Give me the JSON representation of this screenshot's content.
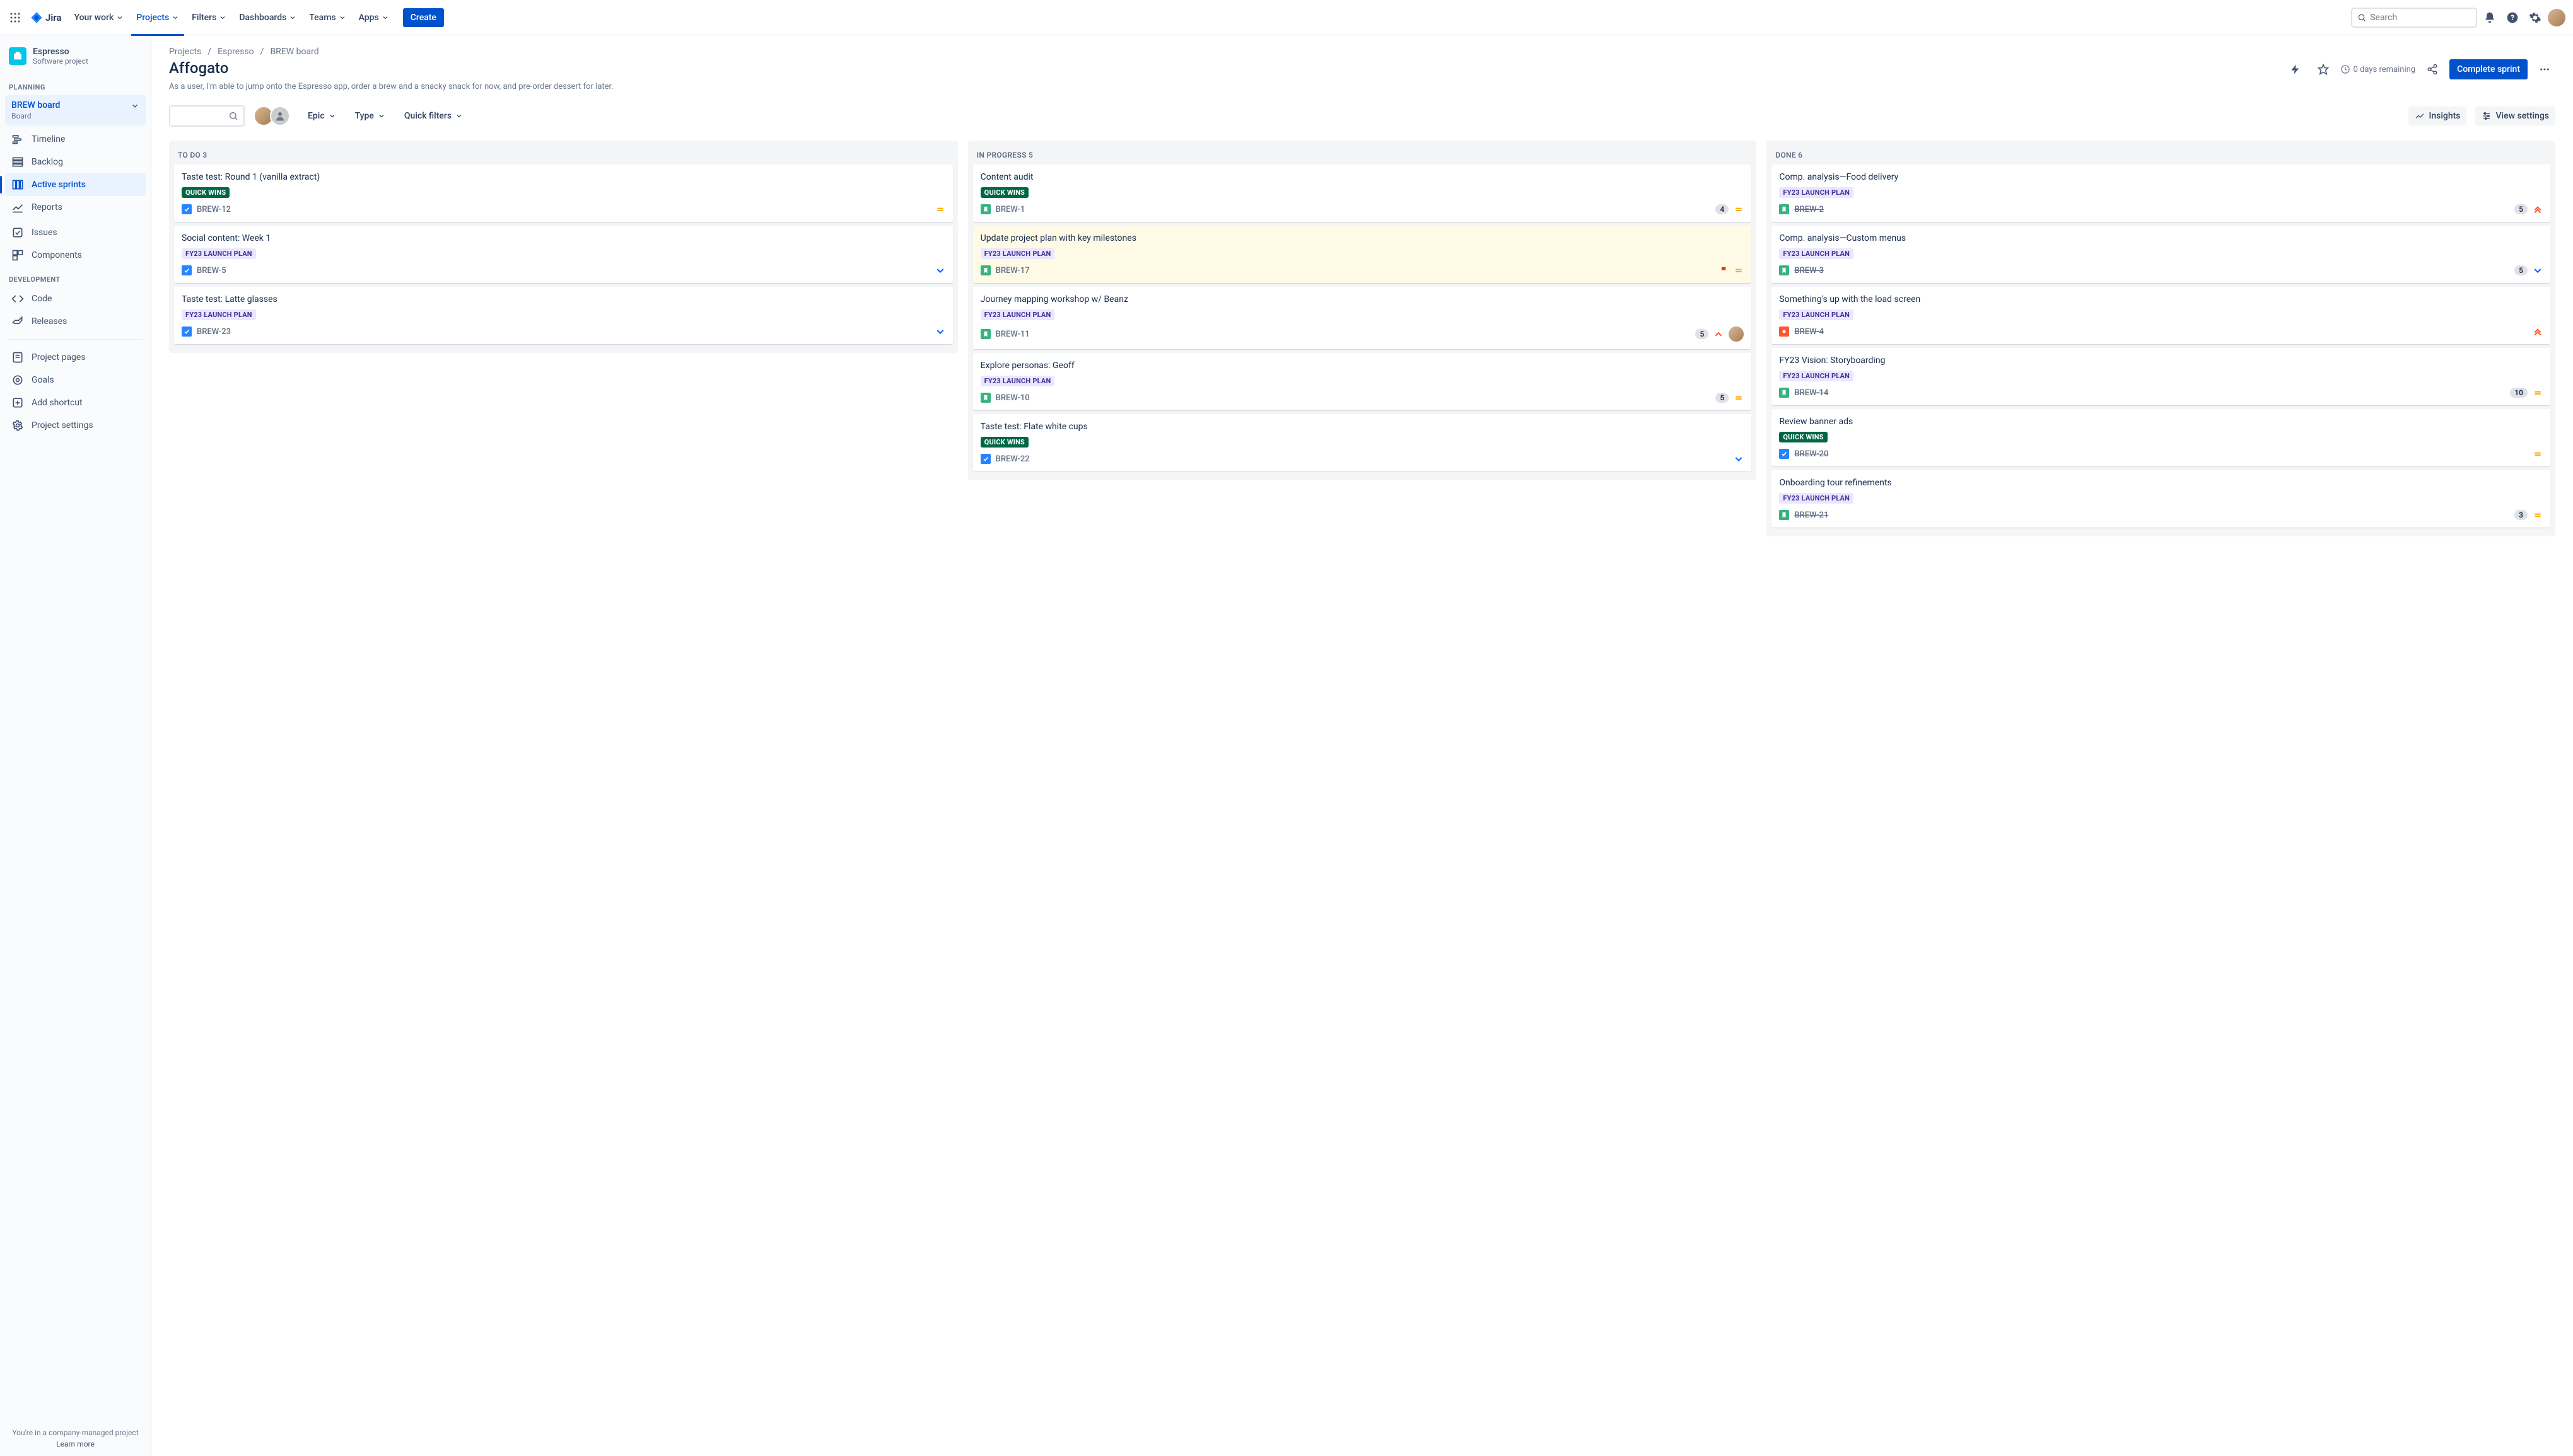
{
  "topbar": {
    "app": "Jira",
    "nav": [
      "Your work",
      "Projects",
      "Filters",
      "Dashboards",
      "Teams",
      "Apps"
    ],
    "nav_active": 1,
    "create": "Create",
    "search_placeholder": "Search"
  },
  "sidebar": {
    "project_name": "Espresso",
    "project_type": "Software project",
    "section_planning": "PLANNING",
    "board_title": "BREW board",
    "board_sub": "Board",
    "rows_plan": [
      "Timeline",
      "Backlog",
      "Active sprints",
      "Reports"
    ],
    "rows_plan_selected": 2,
    "rows_plain": [
      "Issues",
      "Components"
    ],
    "section_dev": "DEVELOPMENT",
    "rows_dev": [
      "Code",
      "Releases"
    ],
    "rows_bottom": [
      "Project pages",
      "Goals",
      "Add shortcut",
      "Project settings"
    ],
    "footer": "You're in a company-managed project",
    "footer_link": "Learn more"
  },
  "crumbs": [
    "Projects",
    "Espresso",
    "BREW board"
  ],
  "page": {
    "title": "Affogato",
    "desc": "As a user, I'm able to jump onto the Espresso app, order a brew and a snacky snack for now, and pre-order dessert for later.",
    "days": "0 days remaining",
    "complete": "Complete sprint"
  },
  "toolbar": {
    "drops": [
      "Epic",
      "Type",
      "Quick filters"
    ],
    "insights": "Insights",
    "viewsettings": "View settings"
  },
  "columns": [
    {
      "name": "TO DO",
      "count": 3,
      "cards": [
        {
          "title": "Taste test: Round 1 (vanilla extract)",
          "label": "QUICK WINS",
          "label_kind": "green",
          "type": "task",
          "key": "BREW-12",
          "done": false,
          "prio": "medium"
        },
        {
          "title": "Social content: Week 1",
          "label": "FY23 LAUNCH PLAN",
          "label_kind": "purple",
          "type": "task",
          "key": "BREW-5",
          "done": false,
          "prio": "low"
        },
        {
          "title": "Taste test: Latte glasses",
          "label": "FY23 LAUNCH PLAN",
          "label_kind": "purple",
          "type": "task",
          "key": "BREW-23",
          "done": false,
          "prio": "low"
        }
      ]
    },
    {
      "name": "IN PROGRESS",
      "count": 5,
      "cards": [
        {
          "title": "Content audit",
          "label": "QUICK WINS",
          "label_kind": "green",
          "type": "story",
          "key": "BREW-1",
          "done": false,
          "pts": 4,
          "prio": "medium"
        },
        {
          "title": "Update project plan with key milestones",
          "label": "FY23 LAUNCH PLAN",
          "label_kind": "purple",
          "type": "story",
          "key": "BREW-17",
          "done": false,
          "flag": true,
          "prio": "medium",
          "highlight": true
        },
        {
          "title": "Journey mapping workshop w/ Beanz",
          "label": "FY23 LAUNCH PLAN",
          "label_kind": "purple",
          "type": "story",
          "key": "BREW-11",
          "done": false,
          "pts": 5,
          "prio": "high",
          "avatar": true
        },
        {
          "title": "Explore personas: Geoff",
          "label": "FY23 LAUNCH PLAN",
          "label_kind": "purple",
          "type": "story",
          "key": "BREW-10",
          "done": false,
          "pts": 5,
          "prio": "medium"
        },
        {
          "title": "Taste test: Flate white cups",
          "label": "QUICK WINS",
          "label_kind": "green",
          "type": "task",
          "key": "BREW-22",
          "done": false,
          "prio": "low"
        }
      ]
    },
    {
      "name": "DONE",
      "count": 6,
      "cards": [
        {
          "title": "Comp. analysis—Food delivery",
          "label": "FY23 LAUNCH PLAN",
          "label_kind": "purple",
          "type": "story",
          "key": "BREW-2",
          "done": true,
          "pts": 5,
          "prio": "highest"
        },
        {
          "title": "Comp. analysis—Custom menus",
          "label": "FY23 LAUNCH PLAN",
          "label_kind": "purple",
          "type": "story",
          "key": "BREW-3",
          "done": true,
          "pts": 5,
          "prio": "low"
        },
        {
          "title": "Something's up with the load screen",
          "label": "FY23 LAUNCH PLAN",
          "label_kind": "purple",
          "type": "bug",
          "key": "BREW-4",
          "done": true,
          "prio": "highest"
        },
        {
          "title": "FY23 Vision: Storyboarding",
          "label": "FY23 LAUNCH PLAN",
          "label_kind": "purple",
          "type": "story",
          "key": "BREW-14",
          "done": true,
          "pts": 10,
          "prio": "medium"
        },
        {
          "title": "Review banner ads",
          "label": "QUICK WINS",
          "label_kind": "green",
          "type": "task",
          "key": "BREW-20",
          "done": true,
          "prio": "medium"
        },
        {
          "title": "Onboarding tour refinements",
          "label": "FY23 LAUNCH PLAN",
          "label_kind": "purple",
          "type": "story",
          "key": "BREW-21",
          "done": true,
          "pts": 3,
          "prio": "medium"
        }
      ]
    }
  ]
}
